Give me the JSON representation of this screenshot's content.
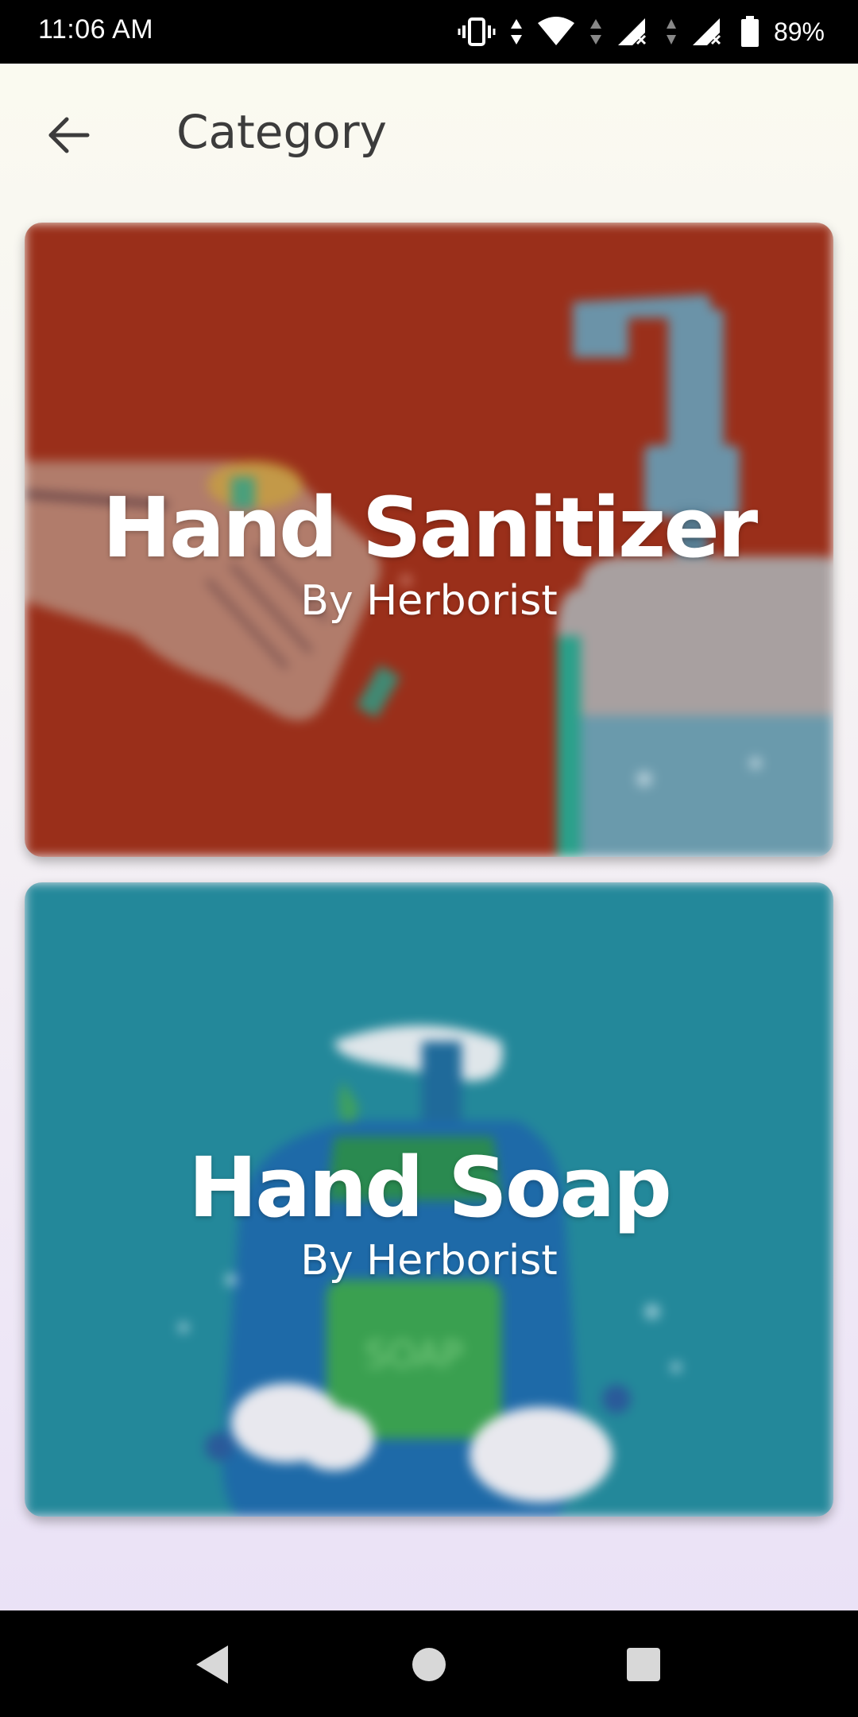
{
  "status_bar": {
    "time": "11:06 AM",
    "battery_percent": "89%",
    "icons": [
      "vibrate-icon",
      "data-arrows-icon",
      "wifi-icon",
      "signal-no-service-icon",
      "signal-no-service-icon",
      "battery-icon"
    ]
  },
  "app_bar": {
    "back_icon": "arrow-left-icon",
    "title": "Category"
  },
  "categories": [
    {
      "title": "Hand Sanitizer",
      "subtitle": "By Herborist",
      "background_color": "#9a2f1a",
      "image": "hand-sanitizer-illustration"
    },
    {
      "title": "Hand Soap",
      "subtitle": "By Herborist",
      "background_color": "#23889a",
      "image": "hand-soap-illustration"
    }
  ],
  "nav_bar": {
    "back_icon": "triangle-back-icon",
    "home_icon": "circle-home-icon",
    "recents_icon": "square-recents-icon"
  }
}
